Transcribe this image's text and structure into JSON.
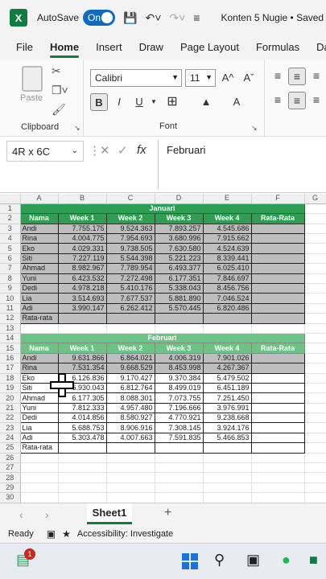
{
  "titlebar": {
    "app_letter": "X",
    "autosave_label": "AutoSave",
    "toggle_label": "On",
    "doc_title": "Konten 5 Nugie • Saved"
  },
  "menu": [
    "File",
    "Home",
    "Insert",
    "Draw",
    "Page Layout",
    "Formulas",
    "Data"
  ],
  "ribbon": {
    "paste_label": "Paste",
    "clipboard_label": "Clipboard",
    "font_name": "Calibri",
    "font_size": "11",
    "font_label": "Font",
    "bold": "B",
    "italic": "I",
    "underline": "U",
    "grow_font": "A^",
    "shrink_font": "Aˇ",
    "font_color": "A"
  },
  "formula_bar": {
    "name_box": "4R x 6C",
    "fx": "fx",
    "content": "Februari"
  },
  "grid": {
    "columns": [
      "A",
      "B",
      "C",
      "D",
      "E",
      "F",
      "G"
    ],
    "rows": [
      "1",
      "2",
      "3",
      "4",
      "5",
      "6",
      "7",
      "8",
      "9",
      "10",
      "11",
      "12",
      "13",
      "14",
      "15",
      "16",
      "17",
      "18",
      "19",
      "20",
      "21",
      "22",
      "23",
      "24",
      "25",
      "26",
      "27",
      "28",
      "29",
      "30"
    ],
    "januari": {
      "title": "Januari",
      "headers": [
        "Nama",
        "Week 1",
        "Week 2",
        "Week 3",
        "Week 4",
        "Rata-Rata"
      ],
      "data": [
        [
          "Andi",
          "7.755.175",
          "9.524.363",
          "7.893.257",
          "4.545.686"
        ],
        [
          "Rina",
          "4.004.775",
          "7.954.693",
          "3.680.996",
          "7.915.662"
        ],
        [
          "Eko",
          "4.029.331",
          "9.738.505",
          "7.630.580",
          "4.524.639"
        ],
        [
          "Siti",
          "7.227.119",
          "5.544.398",
          "5.221.223",
          "8.339.441"
        ],
        [
          "Ahmad",
          "8.982.967",
          "7.789.954",
          "6.493.377",
          "6.025.410"
        ],
        [
          "Yuni",
          "6.423.532",
          "7.272.498",
          "6.177.351",
          "7.846.697"
        ],
        [
          "Dedi",
          "4.978.218",
          "5.410.176",
          "5.338.043",
          "8.456.756"
        ],
        [
          "Lia",
          "3.514.693",
          "7.677.537",
          "5.881.890",
          "7.046.524"
        ],
        [
          "Adi",
          "3.990.147",
          "6.262.412",
          "5.570.445",
          "6.820.486"
        ]
      ],
      "total_label": "Rata-rata"
    },
    "februari": {
      "title": "Februari",
      "headers": [
        "Nama",
        "Week 1",
        "Week 2",
        "Week 3",
        "Week 4",
        "Rata-Rata"
      ],
      "data": [
        [
          "Andi",
          "9.631.866",
          "6.864.021",
          "4.006.319",
          "7.901.026"
        ],
        [
          "Rina",
          "7.531.354",
          "9.668.529",
          "8.453.998",
          "4.267.367"
        ],
        [
          "Eko",
          "6.126.836",
          "9.170.427",
          "9.370.384",
          "5.479.502"
        ],
        [
          "Siti",
          "6.930.043",
          "6.812.764",
          "8.499.019",
          "6.451.189"
        ],
        [
          "Ahmad",
          "6.177.305",
          "8.088.301",
          "7.073.755",
          "7.251.450"
        ],
        [
          "Yuni",
          "7.812.333",
          "4.957.480",
          "7.196.666",
          "3.976.991"
        ],
        [
          "Dedi",
          "4.014.856",
          "8.580.927",
          "4.770.921",
          "9.238.668"
        ],
        [
          "Lia",
          "5.688.753",
          "8.906.916",
          "7.308.145",
          "3.924.176"
        ],
        [
          "Adi",
          "5.303.478",
          "4.007.663",
          "7.591.835",
          "5.466.853"
        ]
      ],
      "total_label": "Rata-rata"
    }
  },
  "sheet_tabs": {
    "active": "Sheet1",
    "add": "+"
  },
  "status": {
    "ready": "Ready",
    "accessibility": "Accessibility: Investigate"
  },
  "taskbar": {
    "badge": "1"
  }
}
